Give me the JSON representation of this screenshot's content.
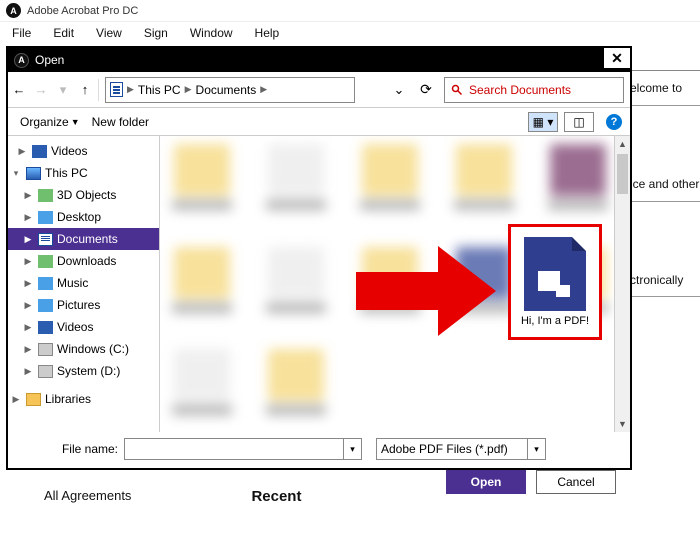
{
  "app": {
    "title": "Adobe Acrobat Pro DC"
  },
  "menu": {
    "file": "File",
    "edit": "Edit",
    "view": "View",
    "sign": "Sign",
    "window": "Window",
    "help": "Help"
  },
  "bg": {
    "welcome": "elcome to",
    "office": "ice and other",
    "esign": "ctronically"
  },
  "bottom": {
    "all": "All Agreements",
    "recent": "Recent"
  },
  "dialog": {
    "title": "Open",
    "breadcrumb": {
      "seg1": "This PC",
      "seg2": "Documents"
    },
    "search": "Search Documents",
    "toolbar": {
      "organize": "Organize",
      "newfolder": "New folder"
    },
    "tree": {
      "videos": "Videos",
      "thispc": "This PC",
      "objects3d": "3D Objects",
      "desktop": "Desktop",
      "documents": "Documents",
      "downloads": "Downloads",
      "music": "Music",
      "pictures": "Pictures",
      "videos2": "Videos",
      "cdrive": "Windows (C:)",
      "ddrive": "System (D:)",
      "libraries": "Libraries"
    },
    "pdf": {
      "label": "Hi, I'm a PDF!"
    },
    "filename_label": "File name:",
    "filter": "Adobe PDF Files (*.pdf)",
    "open": "Open",
    "cancel": "Cancel"
  }
}
